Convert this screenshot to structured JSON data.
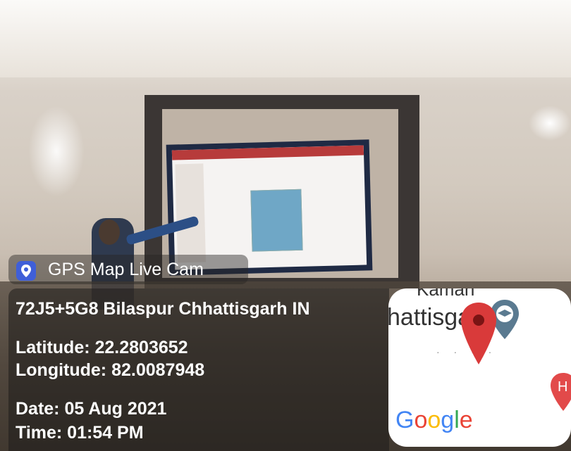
{
  "overlay": {
    "app_name": "GPS Map Live Cam",
    "address": "72J5+5G8 Bilaspur Chhattisgarh IN",
    "latitude": "Latitude: 22.2803652",
    "longitude": "Longitude: 82.0087948",
    "date": "Date: 05 Aug 2021",
    "time": "Time: 01:54 PM"
  },
  "map_thumbnail": {
    "partial_top_label": "Kaman",
    "partial_city_label": "hattisga",
    "attribution": "Google",
    "pin_color": "#d93a3a",
    "education_marker_color": "#5a7a90",
    "hospital_marker_color": "#e24a4a"
  },
  "icons": [
    "location-pin-icon",
    "map-pin-icon",
    "education-marker-icon",
    "hospital-marker-icon"
  ]
}
